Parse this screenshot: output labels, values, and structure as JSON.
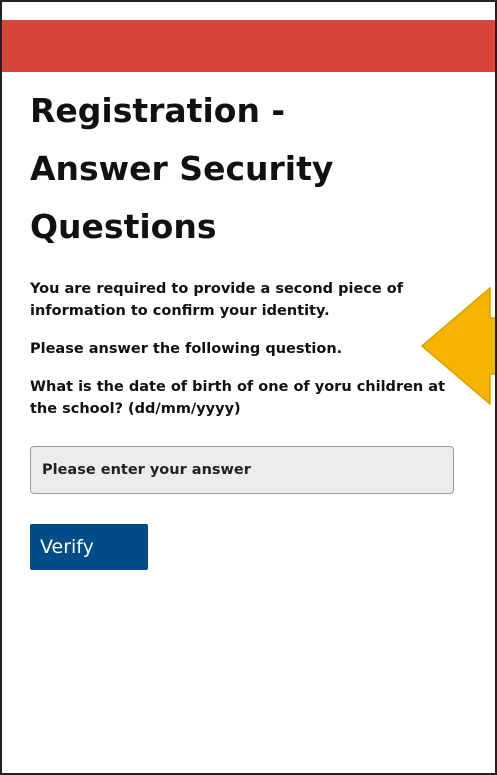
{
  "page": {
    "title": "Registration - Answer Security Questions",
    "intro": "You are required to provide a second piece of information to confirm your identity.",
    "instruction": "Please answer the following question.",
    "question": "What is the date of birth of one of yoru children at the school? (dd/mm/yyyy)"
  },
  "answer_field": {
    "placeholder": "Please enter your answer",
    "value": ""
  },
  "verify_button": {
    "label": "Verify"
  },
  "colors": {
    "header": "#d9443b",
    "button": "#004c86",
    "arrow": "#f5b400"
  }
}
